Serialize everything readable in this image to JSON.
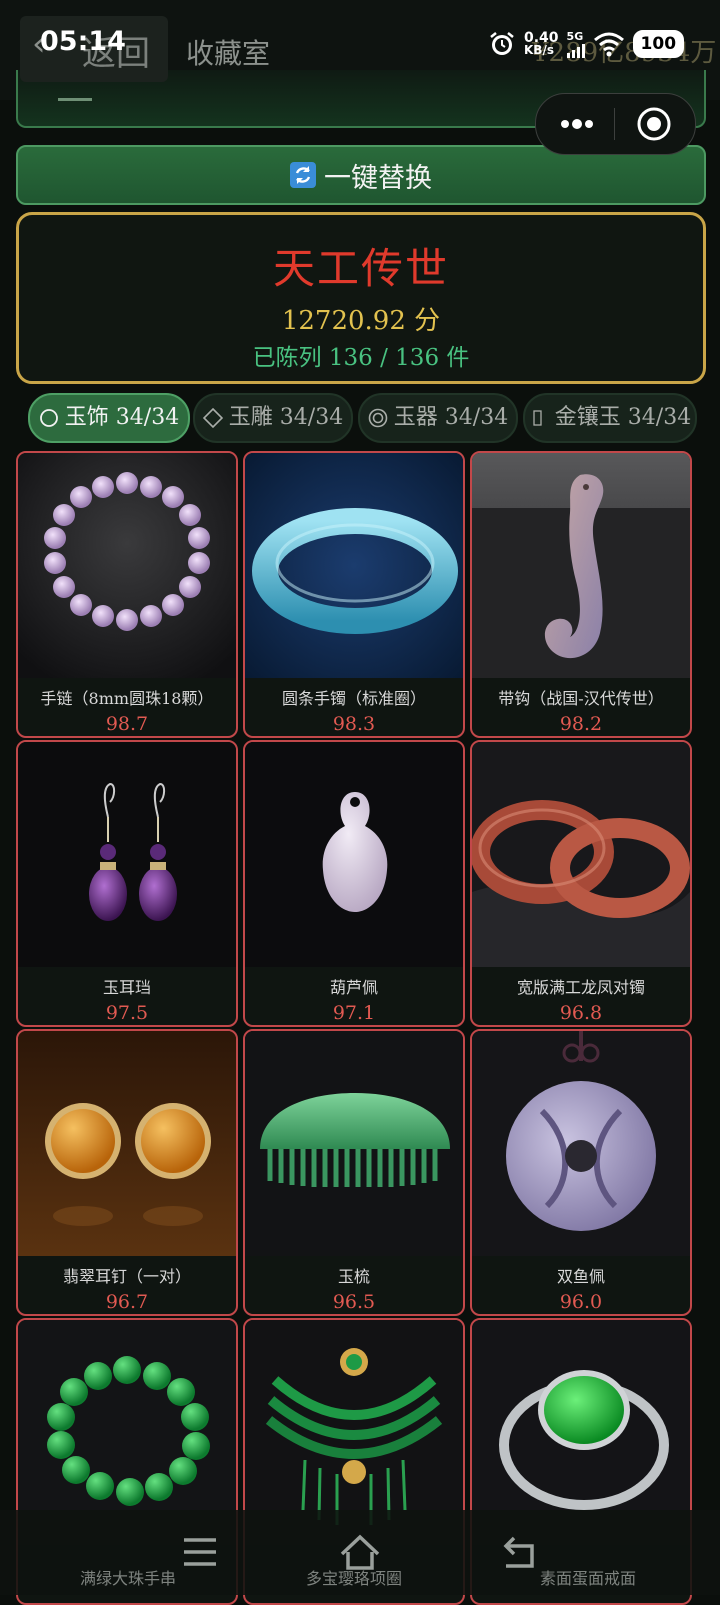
{
  "status_bar": {
    "time": "05:14",
    "net_speed_value": "0.40",
    "net_speed_unit": "KB/s",
    "network": "5G",
    "battery": "100"
  },
  "header": {
    "back_label": "返回",
    "title": "收藏室",
    "right_text": "¥289亿8934万"
  },
  "actions": {
    "replace_label": "一键替换"
  },
  "score_card": {
    "title": "天工传世",
    "score": "12720.92 分",
    "count": "已陈列 136 / 136 件"
  },
  "tabs": [
    {
      "label": "玉饰 34/34",
      "icon": "circle-icon",
      "active": true
    },
    {
      "label": "玉雕 34/34",
      "icon": "diamond-icon",
      "active": false
    },
    {
      "label": "玉器 34/34",
      "icon": "double-circle-icon",
      "active": false
    },
    {
      "label": "金镶玉 34/34",
      "icon": "missing-glyph-icon",
      "active": false
    }
  ],
  "items": [
    {
      "name": "手链（8mm圆珠18颗）",
      "score": "98.7",
      "image": "lavender-bead-bracelet"
    },
    {
      "name": "圆条手镯（标准圈）",
      "score": "98.3",
      "image": "blue-jade-bangle"
    },
    {
      "name": "带钩（战国-汉代传世）",
      "score": "98.2",
      "image": "jade-belt-hook"
    },
    {
      "name": "玉耳珰",
      "score": "97.5",
      "image": "amethyst-earrings"
    },
    {
      "name": "葫芦佩",
      "score": "97.1",
      "image": "jade-gourd-pendant"
    },
    {
      "name": "宽版满工龙凤对镯",
      "score": "96.8",
      "image": "red-jade-bangles"
    },
    {
      "name": "翡翠耳钉（一对）",
      "score": "96.7",
      "image": "amber-stud-earrings"
    },
    {
      "name": "玉梳",
      "score": "96.5",
      "image": "green-jade-comb"
    },
    {
      "name": "双鱼佩",
      "score": "96.0",
      "image": "double-fish-pendant"
    },
    {
      "name": "满绿大珠手串",
      "score": "",
      "image": "green-bead-bracelet"
    },
    {
      "name": "多宝璎珞项圈",
      "score": "",
      "image": "green-gold-necklace"
    },
    {
      "name": "素面蛋面戒面",
      "score": "",
      "image": "green-cabochon-ring"
    }
  ],
  "colors": {
    "accent_green": "#2d6b3e",
    "gold_border": "#c9a548",
    "title_red": "#e03a2c",
    "score_gold": "#e2c24f",
    "count_green": "#49c281",
    "card_border_red": "#c2484a"
  },
  "bottom_nav": [
    {
      "icon": "menu-icon"
    },
    {
      "icon": "home-icon"
    },
    {
      "icon": "back-arrow-icon"
    }
  ]
}
